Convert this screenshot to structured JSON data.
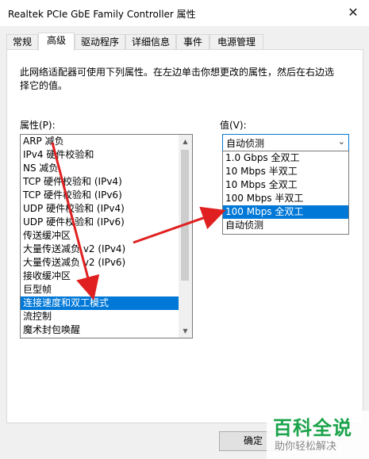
{
  "window": {
    "title": "Realtek PCIe GbE Family Controller 属性",
    "close_glyph": "✕"
  },
  "tabs": [
    {
      "label": "常规"
    },
    {
      "label": "高级"
    },
    {
      "label": "驱动程序"
    },
    {
      "label": "详细信息"
    },
    {
      "label": "事件"
    },
    {
      "label": "电源管理"
    }
  ],
  "active_tab": "高级",
  "description": "此网络适配器可使用下列属性。在左边单击你想更改的属性，然后在右边选择它的值。",
  "property_label": "属性(P):",
  "value_label": "值(V):",
  "properties": [
    "ARP 减负",
    "IPv4 硬件校验和",
    "NS 减负",
    "TCP 硬件校验和 (IPv4)",
    "TCP 硬件校验和 (IPv6)",
    "UDP 硬件校验和 (IPv4)",
    "UDP 硬件校验和 (IPv6)",
    "传送缓冲区",
    "大量传送减负 v2 (IPv4)",
    "大量传送减负 v2 (IPv6)",
    "接收缓冲区",
    "巨型帧",
    "连接速度和双工模式",
    "流控制",
    "魔术封包唤醒"
  ],
  "selected_property": "连接速度和双工模式",
  "value_combo": {
    "value": "自动侦测",
    "arrow_glyph": "⌄"
  },
  "value_options": [
    "1.0 Gbps 全双工",
    "10 Mbps 半双工",
    "10 Mbps 全双工",
    "100 Mbps 半双工",
    "100 Mbps 全双工",
    "自动侦测"
  ],
  "selected_option": "100 Mbps 全双工",
  "buttons": {
    "ok": "确定"
  },
  "watermark": {
    "logo": "百科全说",
    "sub": "助你轻松解决"
  },
  "colors": {
    "accent": "#0078d7",
    "annotation": "#e02020",
    "watermark_green": "#1aa34a"
  }
}
